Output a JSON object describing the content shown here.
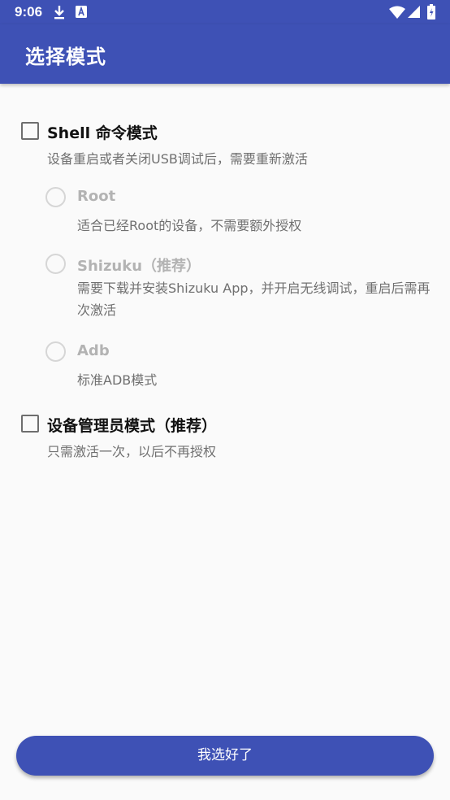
{
  "status_bar": {
    "time": "9:06",
    "left_icons": [
      "download-icon",
      "a-badge-icon"
    ],
    "right_icons": [
      "wifi-icon",
      "signal-icon",
      "battery-icon"
    ],
    "background": "#3e51b5"
  },
  "app_bar": {
    "title": "选择模式",
    "background": "#3e51b5"
  },
  "modes": {
    "shell": {
      "label": "Shell 命令模式",
      "checked": false,
      "description": "设备重启或者关闭USB调试后，需要重新激活",
      "sub_options": [
        {
          "label": "Root",
          "selected": false,
          "enabled": false,
          "description": "适合已经Root的设备，不需要额外授权"
        },
        {
          "label": "Shizuku（推荐）",
          "selected": false,
          "enabled": false,
          "description": "需要下载并安装Shizuku App，并开启无线调试，重启后需再次激活"
        },
        {
          "label": "Adb",
          "selected": false,
          "enabled": false,
          "description": "标准ADB模式"
        }
      ]
    },
    "device_admin": {
      "label": "设备管理员模式（推荐）",
      "checked": false,
      "description": "只需激活一次，以后不再授权"
    }
  },
  "confirm_button": {
    "label": "我选好了",
    "color": "#3e51b5"
  }
}
